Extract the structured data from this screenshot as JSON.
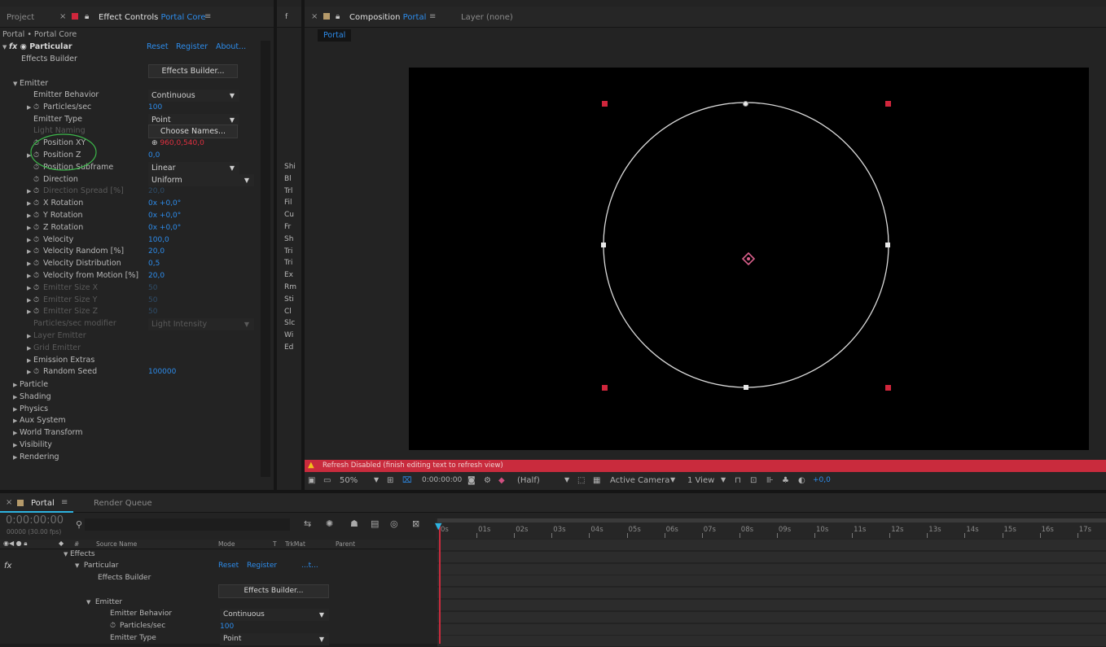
{
  "top_panel_tabs": {
    "project": "Project",
    "effect_controls_prefix": "Effect Controls",
    "effect_controls_layer": "Portal Core",
    "composition_prefix": "Composition",
    "composition_name": "Portal",
    "layer_none": "Layer (none)",
    "comp_subtab": "Portal"
  },
  "effect_controls": {
    "breadcrumb": "Portal • Portal Core",
    "effect_name": "Particular",
    "links": {
      "reset": "Reset",
      "register": "Register",
      "about": "About..."
    },
    "effects_builder_label": "Effects Builder",
    "effects_builder_button": "Effects Builder...",
    "emitter_section": "Emitter",
    "rows": [
      {
        "label": "Emitter Behavior",
        "type": "dropdown",
        "value": "Continuous"
      },
      {
        "label": "Particles/sec",
        "value": "100"
      },
      {
        "label": "Emitter Type",
        "type": "dropdown",
        "value": "Point"
      },
      {
        "label": "Light Naming",
        "type": "button",
        "value": "Choose Names..."
      },
      {
        "label": "Position XY",
        "value": "960,0,540,0"
      },
      {
        "label": "Position Z",
        "value": "0,0"
      },
      {
        "label": "Position Subframe",
        "type": "dropdown",
        "value": "Linear"
      },
      {
        "label": "Direction",
        "type": "dropdown",
        "value": "Uniform"
      },
      {
        "label": "Direction Spread [%]",
        "value": "20,0"
      },
      {
        "label": "X Rotation",
        "value": "0x +0,0°"
      },
      {
        "label": "Y Rotation",
        "value": "0x +0,0°"
      },
      {
        "label": "Z Rotation",
        "value": "0x +0,0°"
      },
      {
        "label": "Velocity",
        "value": "100,0"
      },
      {
        "label": "Velocity Random [%]",
        "value": "20,0"
      },
      {
        "label": "Velocity Distribution",
        "value": "0,5"
      },
      {
        "label": "Velocity from Motion [%]",
        "value": "20,0"
      },
      {
        "label": "Emitter Size X",
        "value": "50"
      },
      {
        "label": "Emitter Size Y",
        "value": "50"
      },
      {
        "label": "Emitter Size Z",
        "value": "50"
      },
      {
        "label": "Particles/sec modifier",
        "type": "dropdown",
        "value": "Light Intensity"
      },
      {
        "label": "Layer Emitter"
      },
      {
        "label": "Grid Emitter"
      },
      {
        "label": "Emission Extras"
      },
      {
        "label": "Random Seed",
        "value": "100000"
      }
    ],
    "groups": [
      "Particle",
      "Shading",
      "Physics",
      "Aux System",
      "World Transform",
      "Visibility",
      "Rendering"
    ]
  },
  "side_panel_items": [
    "f",
    "Shi",
    "Bl",
    "Trl",
    "Fil",
    "Cu",
    "Fr",
    "Sh",
    "Tri",
    "Tri",
    "Ex",
    "Rm",
    "Sti",
    "Cl",
    "Slc",
    "Wi",
    "Ed"
  ],
  "viewer": {
    "warning": "Refresh Disabled (finish editing text to refresh view)",
    "zoom": "50%",
    "timecode": "0:00:00:00",
    "resolution": "(Half)",
    "camera": "Active Camera",
    "views": "1 View",
    "exposure": "+0,0"
  },
  "timeline": {
    "tab": "Portal",
    "render_queue": "Render Queue",
    "timecode": "0:00:00:00",
    "frame_info": "00000 (30.00 fps)",
    "search_placeholder": "",
    "columns": {
      "hash": "#",
      "source": "Source Name",
      "mode": "Mode",
      "t": "T",
      "trkmat": "TrkMat",
      "parent": "Parent"
    },
    "ruler": [
      "0s",
      "01s",
      "02s",
      "03s",
      "04s",
      "05s",
      "06s",
      "07s",
      "08s",
      "09s",
      "10s",
      "11s",
      "12s",
      "13s",
      "14s",
      "15s",
      "16s",
      "17s"
    ],
    "layers": {
      "effects": "Effects",
      "particular": "Particular",
      "reset": "Reset",
      "register": "Register",
      "about": "...t...",
      "effects_builder": "Effects Builder",
      "effects_builder_button": "Effects Builder...",
      "emitter": "Emitter",
      "emitter_behavior": "Emitter Behavior",
      "emitter_behavior_value": "Continuous",
      "particles_sec": "Particles/sec",
      "particles_sec_value": "100",
      "emitter_type": "Emitter Type",
      "emitter_type_value": "Point"
    }
  },
  "colors": {
    "accent": "#2d8ceb",
    "warning_bar": "#c92b3d",
    "handle": "#d0263c",
    "playhead": "#2db3e0"
  }
}
